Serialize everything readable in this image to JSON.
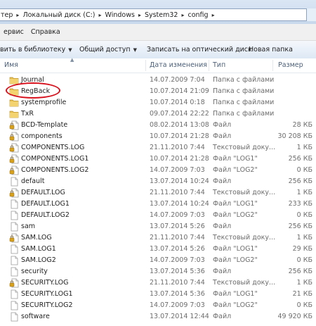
{
  "address_bar": {
    "crumbs": [
      "тер",
      "Локальный диск (C:)",
      "Windows",
      "System32",
      "config"
    ]
  },
  "menu": [
    "ервис",
    "Справка"
  ],
  "toolbar": {
    "add_to_library": "вить в библиотеку",
    "share": "Общий доступ",
    "burn": "Записать на оптический диск",
    "new_folder": "Новая папка"
  },
  "columns": {
    "name": "Имя",
    "date": "Дата изменения",
    "type": "Тип",
    "size": "Размер"
  },
  "files": [
    {
      "name": "Journal",
      "date": "14.07.2009 7:04",
      "type": "Папка с файлами",
      "size": "",
      "icon": "folder-icon"
    },
    {
      "name": "RegBack",
      "date": "10.07.2014 21:09",
      "type": "Папка с файлами",
      "size": "",
      "icon": "folder-icon"
    },
    {
      "name": "systemprofile",
      "date": "10.07.2014 0:18",
      "type": "Папка с файлами",
      "size": "",
      "icon": "folder-icon"
    },
    {
      "name": "TxR",
      "date": "09.07.2014 22:22",
      "type": "Папка с файлами",
      "size": "",
      "icon": "folder-icon"
    },
    {
      "name": "BCD-Template",
      "date": "08.02.2014 13:08",
      "type": "Файл",
      "size": "28 КБ",
      "icon": "locked-file-icon"
    },
    {
      "name": "components",
      "date": "10.07.2014 21:28",
      "type": "Файл",
      "size": "30 208 КБ",
      "icon": "locked-file-icon"
    },
    {
      "name": "COMPONENTS.LOG",
      "date": "21.11.2010 7:44",
      "type": "Текстовый доку...",
      "size": "1 КБ",
      "icon": "locked-file-icon"
    },
    {
      "name": "COMPONENTS.LOG1",
      "date": "10.07.2014 21:28",
      "type": "Файл \"LOG1\"",
      "size": "256 КБ",
      "icon": "locked-file-icon"
    },
    {
      "name": "COMPONENTS.LOG2",
      "date": "14.07.2009 7:03",
      "type": "Файл \"LOG2\"",
      "size": "0 КБ",
      "icon": "locked-file-icon"
    },
    {
      "name": "default",
      "date": "13.07.2014 10:24",
      "type": "Файл",
      "size": "256 КБ",
      "icon": "file-icon"
    },
    {
      "name": "DEFAULT.LOG",
      "date": "21.11.2010 7:44",
      "type": "Текстовый доку...",
      "size": "1 КБ",
      "icon": "locked-file-icon"
    },
    {
      "name": "DEFAULT.LOG1",
      "date": "13.07.2014 10:24",
      "type": "Файл \"LOG1\"",
      "size": "233 КБ",
      "icon": "file-icon"
    },
    {
      "name": "DEFAULT.LOG2",
      "date": "14.07.2009 7:03",
      "type": "Файл \"LOG2\"",
      "size": "0 КБ",
      "icon": "file-icon"
    },
    {
      "name": "sam",
      "date": "13.07.2014 5:26",
      "type": "Файл",
      "size": "256 КБ",
      "icon": "file-icon"
    },
    {
      "name": "SAM.LOG",
      "date": "21.11.2010 7:44",
      "type": "Текстовый доку...",
      "size": "1 КБ",
      "icon": "locked-file-icon"
    },
    {
      "name": "SAM.LOG1",
      "date": "13.07.2014 5:26",
      "type": "Файл \"LOG1\"",
      "size": "29 КБ",
      "icon": "file-icon"
    },
    {
      "name": "SAM.LOG2",
      "date": "14.07.2009 7:03",
      "type": "Файл \"LOG2\"",
      "size": "0 КБ",
      "icon": "file-icon"
    },
    {
      "name": "security",
      "date": "13.07.2014 5:36",
      "type": "Файл",
      "size": "256 КБ",
      "icon": "file-icon"
    },
    {
      "name": "SECURITY.LOG",
      "date": "21.11.2010 7:44",
      "type": "Текстовый доку...",
      "size": "1 КБ",
      "icon": "locked-file-icon"
    },
    {
      "name": "SECURITY.LOG1",
      "date": "13.07.2014 5:36",
      "type": "Файл \"LOG1\"",
      "size": "21 КБ",
      "icon": "file-icon"
    },
    {
      "name": "SECURITY.LOG2",
      "date": "14.07.2009 7:03",
      "type": "Файл \"LOG2\"",
      "size": "0 КБ",
      "icon": "file-icon"
    },
    {
      "name": "software",
      "date": "13.07.2014 12:44",
      "type": "Файл",
      "size": "49 920 КБ",
      "icon": "file-icon"
    }
  ],
  "colors": {
    "highlight": "#d8101c",
    "folder": "#e8c04e",
    "lock": "#d9a21b"
  }
}
